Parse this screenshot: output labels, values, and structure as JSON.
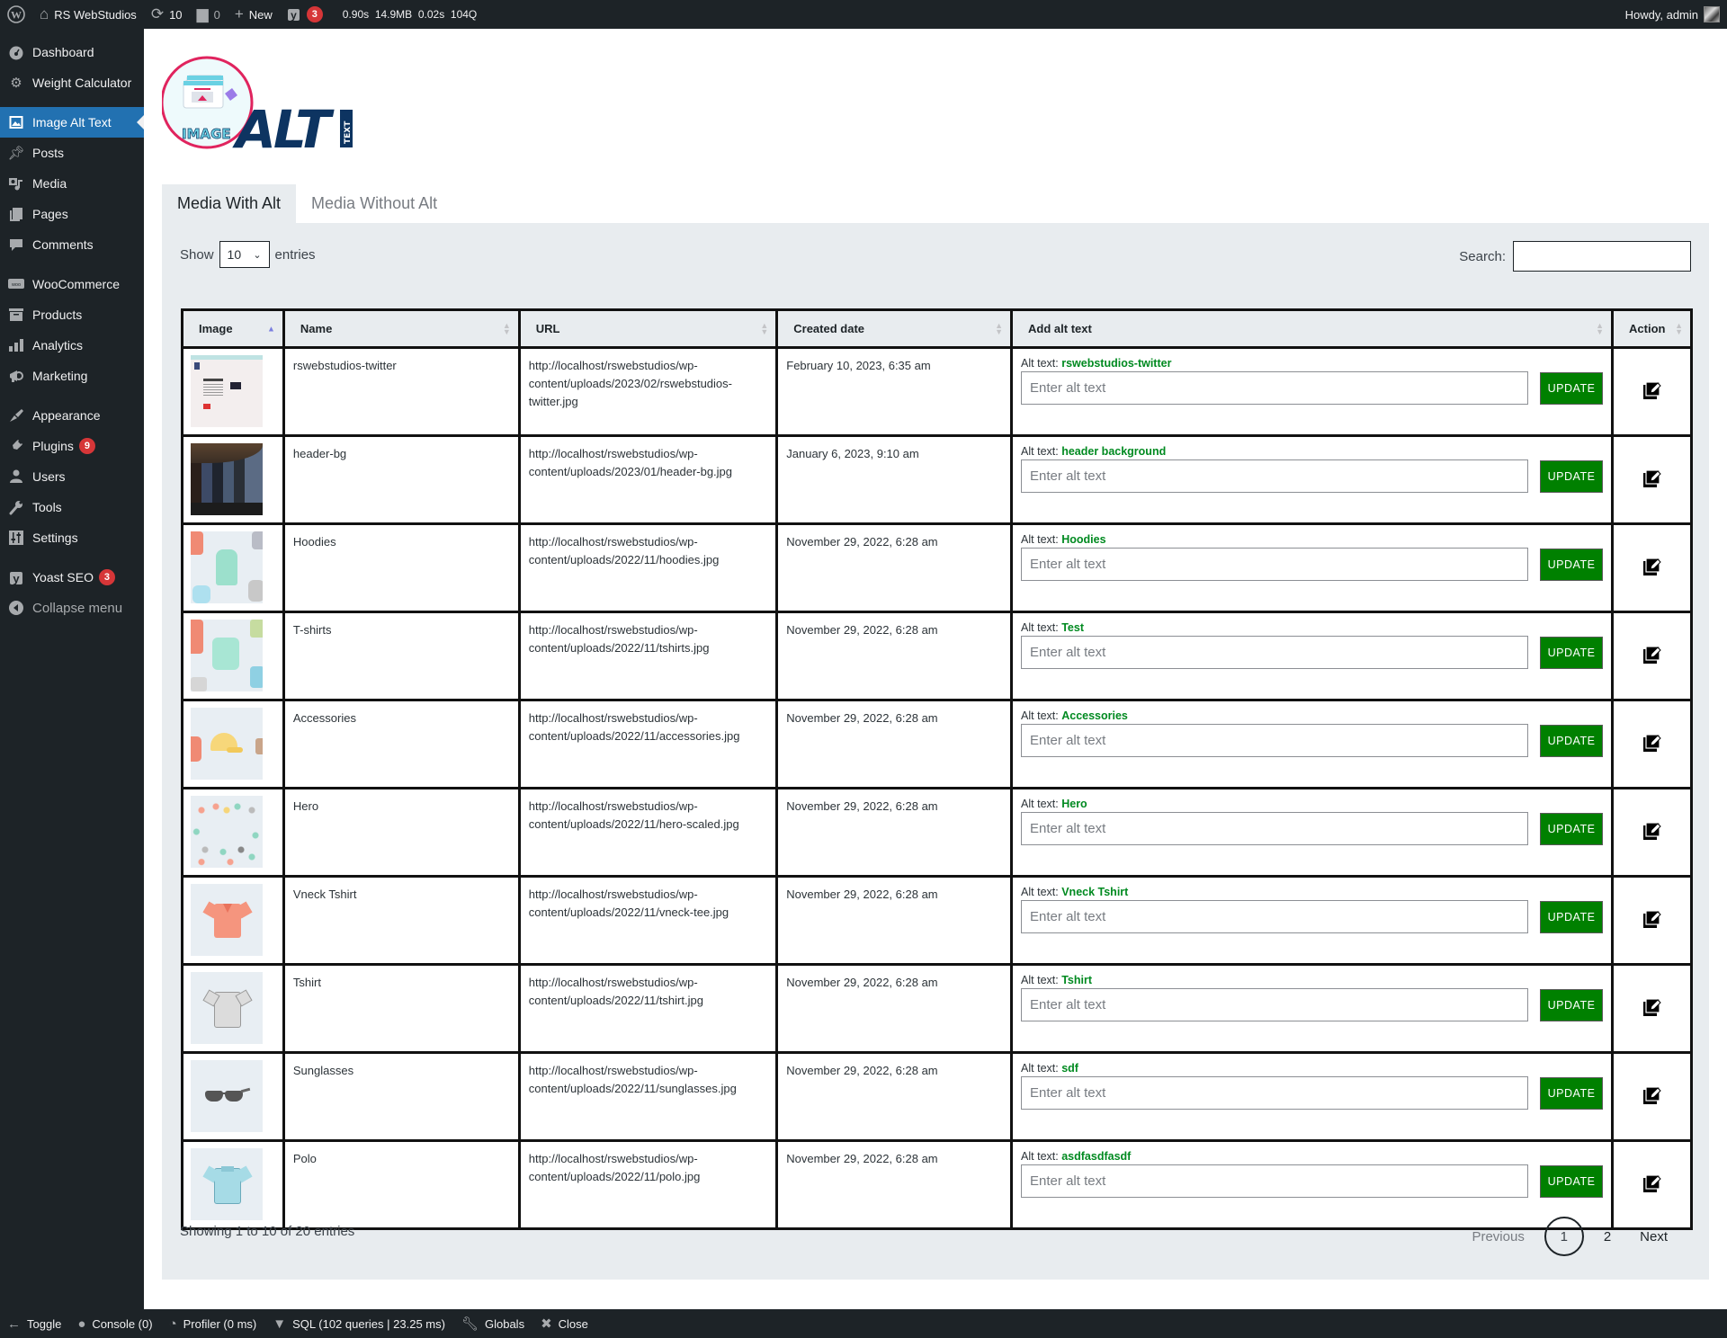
{
  "adminbar": {
    "site_name": "RS WebStudios",
    "updates_count": "10",
    "comments_count": "0",
    "new_label": "New",
    "yoast_badge": "3",
    "qm_time": "0.90s",
    "qm_memory": "14.9MB",
    "qm_db_time": "0.02s",
    "qm_queries": "104Q",
    "howdy": "Howdy, admin"
  },
  "sidebar": {
    "items": [
      {
        "label": "Dashboard",
        "icon": "dashboard-icon"
      },
      {
        "label": "Weight Calculator",
        "icon": "gear-icon"
      },
      {
        "label": "Image Alt Text",
        "icon": "image-icon",
        "active": true
      },
      {
        "label": "Posts",
        "icon": "pin-icon"
      },
      {
        "label": "Media",
        "icon": "media-icon"
      },
      {
        "label": "Pages",
        "icon": "pages-icon"
      },
      {
        "label": "Comments",
        "icon": "comment-icon"
      },
      {
        "label": "WooCommerce",
        "icon": "woo-icon"
      },
      {
        "label": "Products",
        "icon": "archive-icon"
      },
      {
        "label": "Analytics",
        "icon": "chart-bar-icon"
      },
      {
        "label": "Marketing",
        "icon": "megaphone-icon"
      },
      {
        "label": "Appearance",
        "icon": "brush-icon"
      },
      {
        "label": "Plugins",
        "icon": "plugin-icon",
        "badge": "9"
      },
      {
        "label": "Users",
        "icon": "user-icon"
      },
      {
        "label": "Tools",
        "icon": "wrench-icon"
      },
      {
        "label": "Settings",
        "icon": "sliders-icon"
      },
      {
        "label": "Yoast SEO",
        "icon": "yoast-icon",
        "badge": "3"
      },
      {
        "label": "Collapse menu",
        "icon": "collapse-icon"
      }
    ]
  },
  "logo": {
    "word_image": "IMAGE",
    "word_alt": "ALT",
    "word_text": "TEXT"
  },
  "tabs": [
    {
      "label": "Media With Alt",
      "active": true
    },
    {
      "label": "Media Without Alt",
      "active": false
    }
  ],
  "table_controls": {
    "show_label": "Show",
    "entries_label": "entries",
    "page_length": "10",
    "search_label": "Search:",
    "search_value": ""
  },
  "table": {
    "columns": [
      "Image",
      "Name",
      "URL",
      "Created date",
      "Add alt text",
      "Action"
    ],
    "alt_prefix": "Alt text:",
    "input_placeholder": "Enter alt text",
    "update_label": "UPDATE",
    "rows": [
      {
        "name": "rswebstudios-twitter",
        "url": "http://localhost/rswebstudios/wp-content/uploads/2023/02/rswebstudios-twitter.jpg",
        "date": "February 10, 2023, 6:35 am",
        "alt": "rswebstudios-twitter",
        "thumb": "screenshot"
      },
      {
        "name": "header-bg",
        "url": "http://localhost/rswebstudios/wp-content/uploads/2023/01/header-bg.jpg",
        "date": "January 6, 2023, 9:10 am",
        "alt": "header background",
        "thumb": "dark"
      },
      {
        "name": "Hoodies",
        "url": "http://localhost/rswebstudios/wp-content/uploads/2022/11/hoodies.jpg",
        "date": "November 29, 2022, 6:28 am",
        "alt": "Hoodies",
        "thumb": "hoodies"
      },
      {
        "name": "T-shirts",
        "url": "http://localhost/rswebstudios/wp-content/uploads/2022/11/tshirts.jpg",
        "date": "November 29, 2022, 6:28 am",
        "alt": "Test",
        "thumb": "tshirts"
      },
      {
        "name": "Accessories",
        "url": "http://localhost/rswebstudios/wp-content/uploads/2022/11/accessories.jpg",
        "date": "November 29, 2022, 6:28 am",
        "alt": "Accessories",
        "thumb": "accessories"
      },
      {
        "name": "Hero",
        "url": "http://localhost/rswebstudios/wp-content/uploads/2022/11/hero-scaled.jpg",
        "date": "November 29, 2022, 6:28 am",
        "alt": "Hero",
        "thumb": "hero"
      },
      {
        "name": "Vneck Tshirt",
        "url": "http://localhost/rswebstudios/wp-content/uploads/2022/11/vneck-tee.jpg",
        "date": "November 29, 2022, 6:28 am",
        "alt": "Vneck Tshirt",
        "thumb": "vneck"
      },
      {
        "name": "Tshirt",
        "url": "http://localhost/rswebstudios/wp-content/uploads/2022/11/tshirt.jpg",
        "date": "November 29, 2022, 6:28 am",
        "alt": "Tshirt",
        "thumb": "tshirt"
      },
      {
        "name": "Sunglasses",
        "url": "http://localhost/rswebstudios/wp-content/uploads/2022/11/sunglasses.jpg",
        "date": "November 29, 2022, 6:28 am",
        "alt": "sdf",
        "thumb": "sunglasses"
      },
      {
        "name": "Polo",
        "url": "http://localhost/rswebstudios/wp-content/uploads/2022/11/polo.jpg",
        "date": "November 29, 2022, 6:28 am",
        "alt": "asdfasdfasdf",
        "thumb": "polo"
      }
    ]
  },
  "footer": {
    "info": "Showing 1 to 10 of 20 entries",
    "previous": "Previous",
    "pages": [
      "1",
      "2"
    ],
    "current_page": "1",
    "next": "Next"
  },
  "debugbar": {
    "toggle": "Toggle",
    "console": "Console (0)",
    "profiler": "Profiler (0 ms)",
    "sql": "SQL (102 queries | 23.25 ms)",
    "globals": "Globals",
    "close": "Close"
  },
  "colors": {
    "admin_bg": "#1d2327",
    "active_menu": "#2271b1",
    "alt_value": "#008a20",
    "update_button": "#008000",
    "panel_bg": "#e8ecef",
    "logo_navy": "#0d3461",
    "logo_ring": "#e0245e"
  }
}
